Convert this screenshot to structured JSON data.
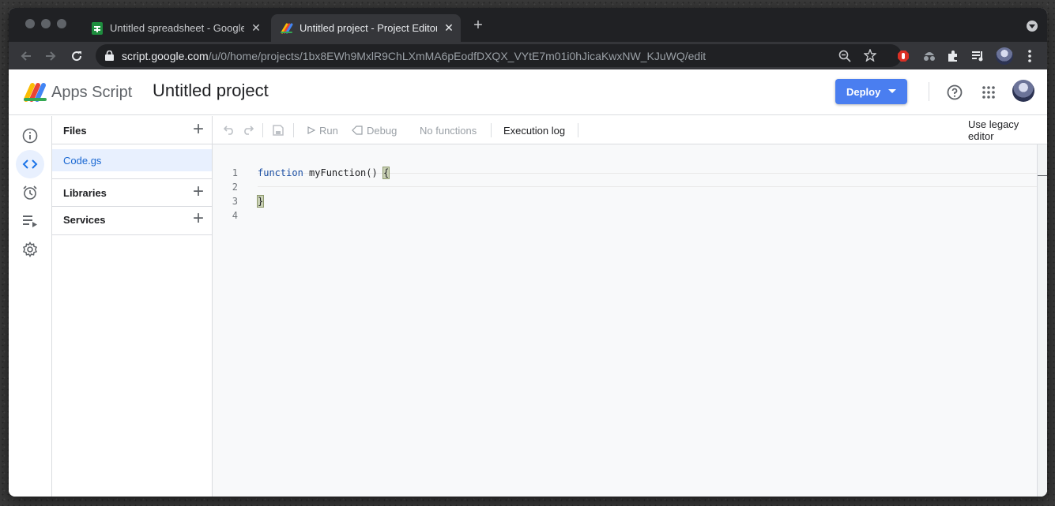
{
  "browser": {
    "tabs": [
      {
        "title": "Untitled spreadsheet - Google Sheets",
        "close": "✕",
        "active": false
      },
      {
        "title": "Untitled project - Project Editor - Apps Script",
        "close": "✕",
        "active": true
      }
    ],
    "new_tab": "+",
    "url": {
      "host": "script.google.com",
      "path": "/u/0/home/projects/1bx8EWh9MxlR9ChLXmMA6pEodfDXQX_VYtE7m01i0hJicaKwxNW_KJuWQ/edit"
    }
  },
  "header": {
    "product": "Apps Script",
    "project_title": "Untitled project",
    "deploy_label": "Deploy"
  },
  "files_panel": {
    "files_label": "Files",
    "files": [
      "Code.gs"
    ],
    "libraries_label": "Libraries",
    "services_label": "Services"
  },
  "editor_toolbar": {
    "run_label": "Run",
    "debug_label": "Debug",
    "function_select": "No functions",
    "execution_log_label": "Execution log",
    "legacy_label": "Use legacy editor"
  },
  "code": {
    "lines": [
      {
        "num": "1",
        "keyword": "function",
        "rest": " myFunction() ",
        "brace": "{"
      },
      {
        "num": "2",
        "text": ""
      },
      {
        "num": "3",
        "brace": "}"
      },
      {
        "num": "4",
        "text": ""
      }
    ]
  },
  "colors": {
    "accent": "#4a7ef0",
    "active_rail": "#1a73e8",
    "selected_file_bg": "#e8f0fe"
  }
}
